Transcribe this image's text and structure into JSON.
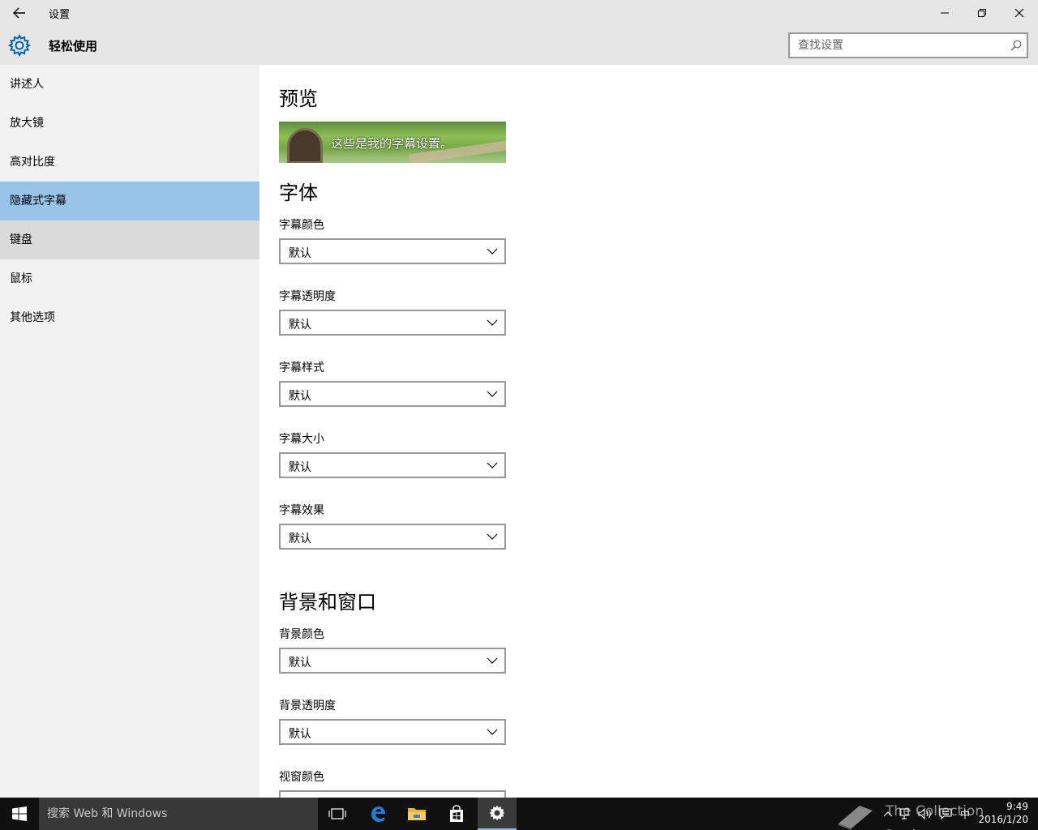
{
  "window": {
    "title": "设置",
    "controls": [
      "minimize",
      "restore",
      "close"
    ]
  },
  "header": {
    "title": "轻松使用",
    "search_placeholder": "查找设置"
  },
  "sidebar": {
    "items": [
      {
        "label": "讲述人"
      },
      {
        "label": "放大镜"
      },
      {
        "label": "高对比度"
      },
      {
        "label": "隐藏式字幕",
        "selected": true
      },
      {
        "label": "键盘"
      },
      {
        "label": "鼠标"
      },
      {
        "label": "其他选项"
      }
    ]
  },
  "content": {
    "preview_title": "预览",
    "preview_text": "这些是我的字幕设置。",
    "font_title": "字体",
    "fields": [
      {
        "label": "字幕颜色",
        "value": "默认"
      },
      {
        "label": "字幕透明度",
        "value": "默认"
      },
      {
        "label": "字幕样式",
        "value": "默认"
      },
      {
        "label": "字幕大小",
        "value": "默认"
      },
      {
        "label": "字幕效果",
        "value": "默认"
      }
    ],
    "background_title": "背景和窗口",
    "bg_fields": [
      {
        "label": "背景颜色",
        "value": "默认"
      },
      {
        "label": "背景透明度",
        "value": "默认"
      },
      {
        "label": "视窗颜色",
        "value": ""
      }
    ]
  },
  "taskbar": {
    "search_text": "搜索 Web 和 Windows",
    "ime": "中",
    "time": "9:49",
    "date": "2016/1/20",
    "watermark": "The Collection Book"
  },
  "colors": {
    "accent": "#0063b1",
    "selected_nav": "#99c4ea",
    "chrome": "#e6e6e6",
    "sidebar": "#f2f2f2",
    "taskbar": "#101010"
  }
}
